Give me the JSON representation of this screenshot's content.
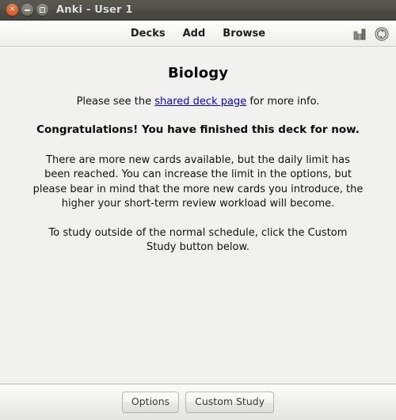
{
  "window": {
    "title": "Anki - User 1",
    "controls": [
      {
        "name": "close",
        "label": "×"
      },
      {
        "name": "minimize",
        "label": ""
      },
      {
        "name": "maximize",
        "label": ""
      }
    ]
  },
  "toolbar": {
    "menu": [
      {
        "id": "decks",
        "label": "Decks"
      },
      {
        "id": "add",
        "label": "Add"
      },
      {
        "id": "browse",
        "label": "Browse"
      }
    ],
    "icons": [
      {
        "id": "stats",
        "name": "bar-chart-icon"
      },
      {
        "id": "sync",
        "name": "sync-icon"
      }
    ]
  },
  "main": {
    "deck_title": "Biology",
    "shared_prefix": "Please see the ",
    "shared_link": "shared deck page",
    "shared_suffix": " for more info.",
    "congrats": "Congratulations! You have finished this deck for now.",
    "paragraph_1": "There are more new cards available, but the daily limit has been reached. You can increase the limit in the options, but please bear in mind that the more new cards you introduce, the higher your short-term review workload will become.",
    "paragraph_2": "To study outside of the normal schedule, click the Custom Study button below."
  },
  "footer": {
    "buttons": [
      {
        "id": "options",
        "label": "Options"
      },
      {
        "id": "custom-study",
        "label": "Custom Study"
      }
    ]
  },
  "colors": {
    "titlebar": "#4e4e47",
    "content_bg": "#f1f1ef",
    "link": "#0000ee",
    "close_button": "#e8612c"
  }
}
